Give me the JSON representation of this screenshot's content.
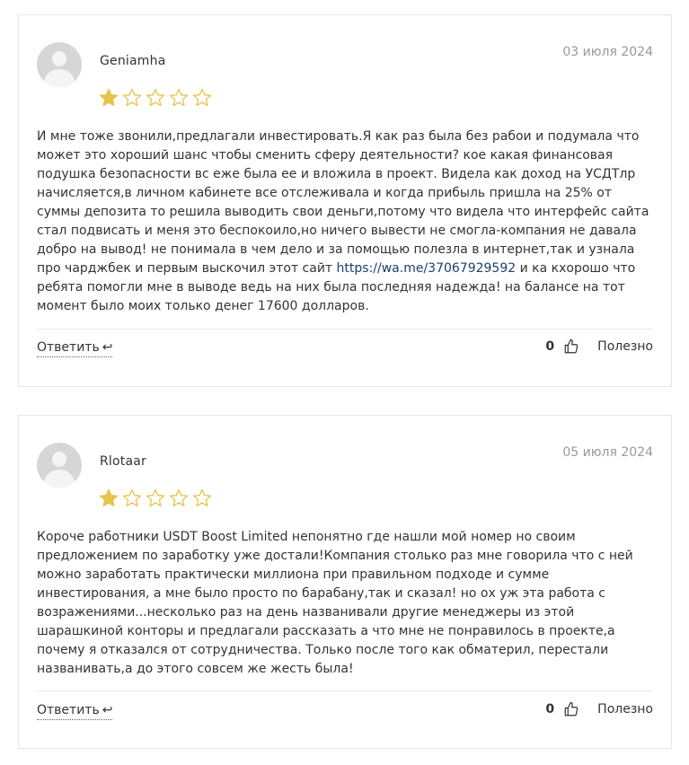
{
  "reviews": [
    {
      "author": "Geniamha",
      "date": "03 июля 2024",
      "rating": 1,
      "max_rating": 5,
      "text_before_link": "И мне тоже звонили,предлагали инвестировать.Я как раз была без рабои и подумала что может это хороший шанс чтобы сменить сферу деятельности? кое какая финансовая подушка безопасности вс еже была ее и вложила в проект. Видела как доход на УСДТлр начисляется,в личном кабинете все отслеживала и когда прибыль пришла на 25% от суммы депозита то решила выводить свои деньги,потому что видела что интерфейс сайта стал подвисать и меня это беспокоило,но ничего вывести не смогла-компания не давала добро на вывод! не понимала в чем дело и за помощью полезла в интернет,так и узнала про чарджбек и первым выскочил этот сайт ",
      "link": "https://wa.me/37067929592",
      "text_after_link": " и ка кхорошо что ребята помогли мне в выводе ведь на них была последняя надежда! на балансе на тот момент было моих только денег 17600 долларов.",
      "reply_label": "Ответить",
      "votes": "0",
      "useful_label": "Полезно"
    },
    {
      "author": "Rlotaar",
      "date": "05 июля 2024",
      "rating": 1,
      "max_rating": 5,
      "text": "Короче работники USDT Boost Limited непонятно где нашли мой номер но своим предложением по заработку уже достали!Компания столько раз мне говорила что с ней можно заработать практически миллиона при правильном подходе и сумме инвестирования, а мне было просто по барабану,так и сказал! но ох уж эта работа с возражениями...несколько раз на день названивали другие менеджеры из этой шарашкиной конторы и предлагали рассказать а что мне не понравилось в проекте,а почему я отказался от сотрудничества. Только после того как обматерил, перестали названивать,а до этого совсем же жесть была!",
      "reply_label": "Ответить",
      "votes": "0",
      "useful_label": "Полезно"
    }
  ],
  "colors": {
    "star_filled": "#e8c34a",
    "star_empty_stroke": "#e8c34a",
    "link": "#1d3d6e",
    "date": "#999999",
    "border": "#e6e6e6"
  },
  "icons": {
    "avatar": "default-user-avatar",
    "star": "star-icon",
    "reply": "reply-arrow-icon",
    "like": "thumbs-up-icon"
  }
}
